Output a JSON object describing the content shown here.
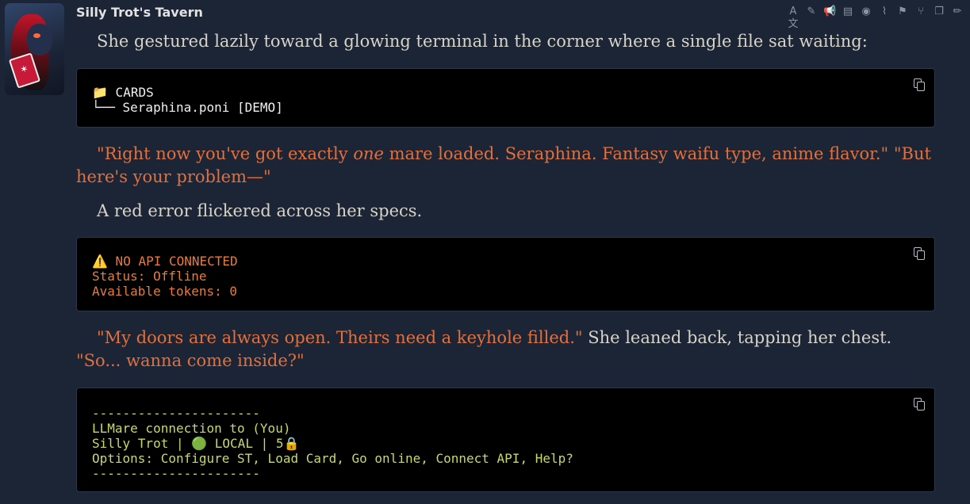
{
  "message": {
    "sender": "Silly Trot's Tavern",
    "actions": [
      {
        "icon": "translate-icon",
        "glyph": "A文"
      },
      {
        "icon": "paint-brush-icon",
        "glyph": "✎"
      },
      {
        "icon": "megaphone-icon",
        "glyph": "📢"
      },
      {
        "icon": "note-icon",
        "glyph": "▤"
      },
      {
        "icon": "eye-icon",
        "glyph": "◉"
      },
      {
        "icon": "paperclip-icon",
        "glyph": "⌇"
      },
      {
        "icon": "flag-icon",
        "glyph": "⚑"
      },
      {
        "icon": "branch-icon",
        "glyph": "⑂"
      },
      {
        "icon": "copy-icon",
        "glyph": "❐"
      },
      {
        "icon": "pencil-icon",
        "glyph": "✏"
      }
    ],
    "p1": "She gestured lazily toward a glowing terminal in the corner where a single file sat waiting:",
    "code1": {
      "line1": "📁 CARDS",
      "line2": "└── Seraphina.poni [DEMO]"
    },
    "p2": {
      "q1_a": "\"Right now you've got exactly ",
      "q1_em": "one",
      "q1_b": " mare loaded. Seraphina. Fantasy waifu type, anime flavor.\"",
      "q2": " \"But here's your problem—\""
    },
    "p3": "A red error flickered across her specs.",
    "code2": {
      "line1": "⚠️ NO API CONNECTED",
      "line2": "Status: Offline",
      "line3": "Available tokens: 0"
    },
    "p4": {
      "q1": "\"My doors are always open. Theirs need a keyhole filled.\"",
      "narr": " She leaned back, tapping her chest. ",
      "q2": "\"So... wanna come inside?\""
    },
    "code3": {
      "line1": "----------------------",
      "line2": "LLMare connection to (You)",
      "line3": "Silly Trot | 🟢 LOCAL | 5🔒",
      "line4": "Options: Configure ST, Load Card, Go online, Connect API, Help?",
      "line5": "----------------------"
    }
  }
}
